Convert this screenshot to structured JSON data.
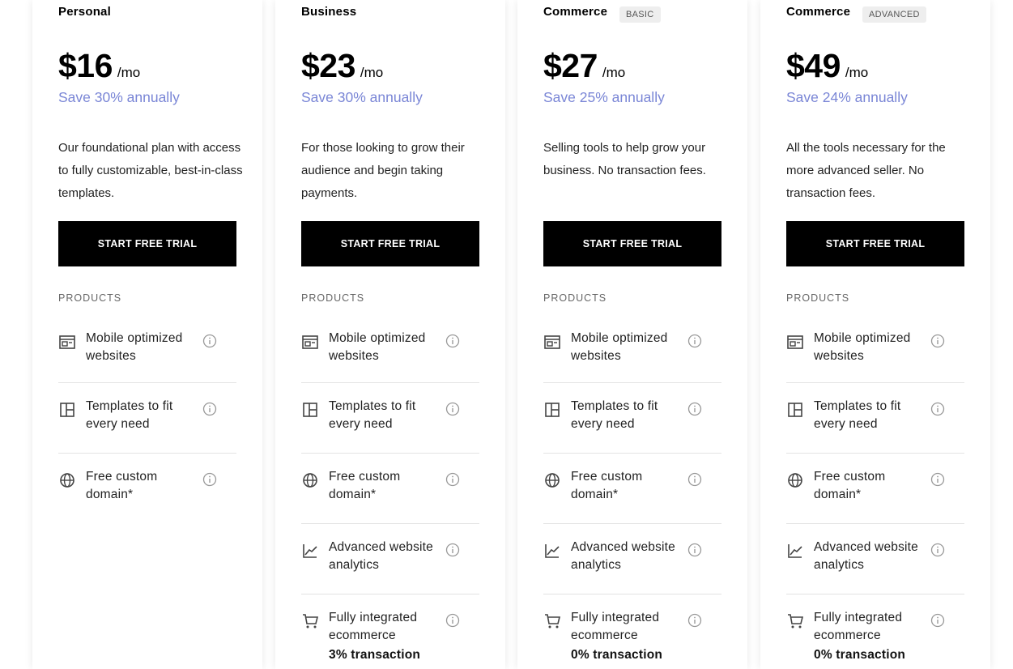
{
  "button_label": "START FREE TRIAL",
  "products_label": "PRODUCTS",
  "accent_colors": {
    "save": "#7a86d6",
    "button_bg": "#000000"
  },
  "feature_labels": {
    "mobile": "Mobile optimized websites",
    "templates": "Templates to fit every need",
    "domain": "Free custom domain*",
    "analytics": "Advanced website analytics",
    "ecommerce": "Fully integrated ecommerce"
  },
  "plans": [
    {
      "name": "Personal",
      "badge": "",
      "price": "$16",
      "period": "/mo",
      "save": "Save 30% annually",
      "description": "Our foundational plan with access to fully customizable, best-in-class templates.",
      "ecommerce_note": ""
    },
    {
      "name": "Business",
      "badge": "",
      "price": "$23",
      "period": "/mo",
      "save": "Save 30% annually",
      "description": "For those looking to grow their audience and begin taking payments.",
      "ecommerce_note": "3% transaction"
    },
    {
      "name": "Commerce",
      "badge": "BASIC",
      "price": "$27",
      "period": "/mo",
      "save": "Save 25% annually",
      "description": "Selling tools to help grow your business. No transaction fees.",
      "ecommerce_note": "0% transaction"
    },
    {
      "name": "Commerce",
      "badge": "ADVANCED",
      "price": "$49",
      "period": "/mo",
      "save": "Save 24% annually",
      "description": "All the tools necessary for the more advanced seller. No transaction fees.",
      "ecommerce_note": "0% transaction"
    }
  ]
}
